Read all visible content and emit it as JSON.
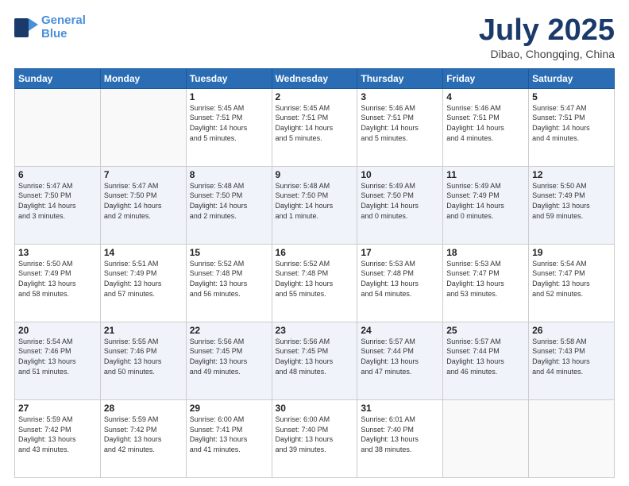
{
  "header": {
    "logo_line1": "General",
    "logo_line2": "Blue",
    "month": "July 2025",
    "location": "Dibao, Chongqing, China"
  },
  "weekdays": [
    "Sunday",
    "Monday",
    "Tuesday",
    "Wednesday",
    "Thursday",
    "Friday",
    "Saturday"
  ],
  "weeks": [
    [
      {
        "day": "",
        "info": ""
      },
      {
        "day": "",
        "info": ""
      },
      {
        "day": "1",
        "info": "Sunrise: 5:45 AM\nSunset: 7:51 PM\nDaylight: 14 hours\nand 5 minutes."
      },
      {
        "day": "2",
        "info": "Sunrise: 5:45 AM\nSunset: 7:51 PM\nDaylight: 14 hours\nand 5 minutes."
      },
      {
        "day": "3",
        "info": "Sunrise: 5:46 AM\nSunset: 7:51 PM\nDaylight: 14 hours\nand 5 minutes."
      },
      {
        "day": "4",
        "info": "Sunrise: 5:46 AM\nSunset: 7:51 PM\nDaylight: 14 hours\nand 4 minutes."
      },
      {
        "day": "5",
        "info": "Sunrise: 5:47 AM\nSunset: 7:51 PM\nDaylight: 14 hours\nand 4 minutes."
      }
    ],
    [
      {
        "day": "6",
        "info": "Sunrise: 5:47 AM\nSunset: 7:50 PM\nDaylight: 14 hours\nand 3 minutes."
      },
      {
        "day": "7",
        "info": "Sunrise: 5:47 AM\nSunset: 7:50 PM\nDaylight: 14 hours\nand 2 minutes."
      },
      {
        "day": "8",
        "info": "Sunrise: 5:48 AM\nSunset: 7:50 PM\nDaylight: 14 hours\nand 2 minutes."
      },
      {
        "day": "9",
        "info": "Sunrise: 5:48 AM\nSunset: 7:50 PM\nDaylight: 14 hours\nand 1 minute."
      },
      {
        "day": "10",
        "info": "Sunrise: 5:49 AM\nSunset: 7:50 PM\nDaylight: 14 hours\nand 0 minutes."
      },
      {
        "day": "11",
        "info": "Sunrise: 5:49 AM\nSunset: 7:49 PM\nDaylight: 14 hours\nand 0 minutes."
      },
      {
        "day": "12",
        "info": "Sunrise: 5:50 AM\nSunset: 7:49 PM\nDaylight: 13 hours\nand 59 minutes."
      }
    ],
    [
      {
        "day": "13",
        "info": "Sunrise: 5:50 AM\nSunset: 7:49 PM\nDaylight: 13 hours\nand 58 minutes."
      },
      {
        "day": "14",
        "info": "Sunrise: 5:51 AM\nSunset: 7:49 PM\nDaylight: 13 hours\nand 57 minutes."
      },
      {
        "day": "15",
        "info": "Sunrise: 5:52 AM\nSunset: 7:48 PM\nDaylight: 13 hours\nand 56 minutes."
      },
      {
        "day": "16",
        "info": "Sunrise: 5:52 AM\nSunset: 7:48 PM\nDaylight: 13 hours\nand 55 minutes."
      },
      {
        "day": "17",
        "info": "Sunrise: 5:53 AM\nSunset: 7:48 PM\nDaylight: 13 hours\nand 54 minutes."
      },
      {
        "day": "18",
        "info": "Sunrise: 5:53 AM\nSunset: 7:47 PM\nDaylight: 13 hours\nand 53 minutes."
      },
      {
        "day": "19",
        "info": "Sunrise: 5:54 AM\nSunset: 7:47 PM\nDaylight: 13 hours\nand 52 minutes."
      }
    ],
    [
      {
        "day": "20",
        "info": "Sunrise: 5:54 AM\nSunset: 7:46 PM\nDaylight: 13 hours\nand 51 minutes."
      },
      {
        "day": "21",
        "info": "Sunrise: 5:55 AM\nSunset: 7:46 PM\nDaylight: 13 hours\nand 50 minutes."
      },
      {
        "day": "22",
        "info": "Sunrise: 5:56 AM\nSunset: 7:45 PM\nDaylight: 13 hours\nand 49 minutes."
      },
      {
        "day": "23",
        "info": "Sunrise: 5:56 AM\nSunset: 7:45 PM\nDaylight: 13 hours\nand 48 minutes."
      },
      {
        "day": "24",
        "info": "Sunrise: 5:57 AM\nSunset: 7:44 PM\nDaylight: 13 hours\nand 47 minutes."
      },
      {
        "day": "25",
        "info": "Sunrise: 5:57 AM\nSunset: 7:44 PM\nDaylight: 13 hours\nand 46 minutes."
      },
      {
        "day": "26",
        "info": "Sunrise: 5:58 AM\nSunset: 7:43 PM\nDaylight: 13 hours\nand 44 minutes."
      }
    ],
    [
      {
        "day": "27",
        "info": "Sunrise: 5:59 AM\nSunset: 7:42 PM\nDaylight: 13 hours\nand 43 minutes."
      },
      {
        "day": "28",
        "info": "Sunrise: 5:59 AM\nSunset: 7:42 PM\nDaylight: 13 hours\nand 42 minutes."
      },
      {
        "day": "29",
        "info": "Sunrise: 6:00 AM\nSunset: 7:41 PM\nDaylight: 13 hours\nand 41 minutes."
      },
      {
        "day": "30",
        "info": "Sunrise: 6:00 AM\nSunset: 7:40 PM\nDaylight: 13 hours\nand 39 minutes."
      },
      {
        "day": "31",
        "info": "Sunrise: 6:01 AM\nSunset: 7:40 PM\nDaylight: 13 hours\nand 38 minutes."
      },
      {
        "day": "",
        "info": ""
      },
      {
        "day": "",
        "info": ""
      }
    ]
  ]
}
